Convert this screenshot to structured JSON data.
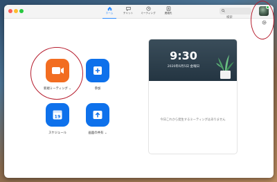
{
  "tabs": [
    {
      "label": "ホーム",
      "icon": "home-icon",
      "active": true
    },
    {
      "label": "チャット",
      "icon": "chat-icon"
    },
    {
      "label": "ミーティング",
      "icon": "clock-icon"
    },
    {
      "label": "連絡先",
      "icon": "contacts-icon"
    }
  ],
  "search": {
    "placeholder": "検索"
  },
  "actions": {
    "new_meeting": "新規ミーティング",
    "join": "参加",
    "schedule": "スケジュール",
    "schedule_day": "19",
    "share_screen": "画面の共有"
  },
  "card": {
    "time": "9:30",
    "date": "2020年6月5日 金曜日",
    "empty_message": "今日これから発生するミーティングはありません"
  },
  "colors": {
    "accent": "#2d8cff",
    "action_blue": "#0e71eb",
    "action_orange": "#f26d21",
    "annotation": "#b51a2b"
  }
}
